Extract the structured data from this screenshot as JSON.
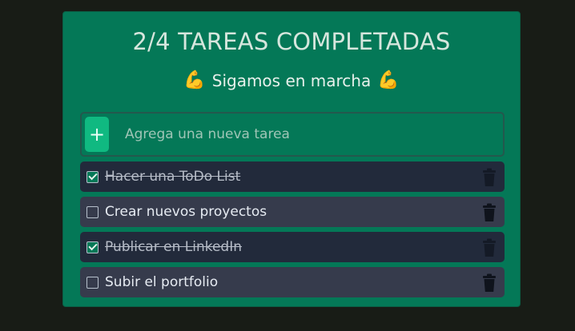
{
  "header": {
    "title": "2/4 TAREAS COMPLETADAS",
    "subtitle": "Sigamos en marcha",
    "emoji_left": "💪",
    "emoji_right": "💪"
  },
  "new_task": {
    "add_label": "+",
    "placeholder": "Agrega una nueva tarea",
    "value": ""
  },
  "tasks": [
    {
      "label": "Hacer una ToDo List",
      "completed": true
    },
    {
      "label": "Crear nuevos proyectos",
      "completed": false
    },
    {
      "label": "Publicar en LinkedIn",
      "completed": true
    },
    {
      "label": "Subir el portfolio",
      "completed": false
    }
  ],
  "icons": {
    "delete": "trash-icon",
    "add": "plus-icon"
  },
  "colors": {
    "background": "#181c16",
    "card": "#047857",
    "add_button": "#10b981",
    "task_done": "#222a3b",
    "task_pending": "#363b4c"
  }
}
